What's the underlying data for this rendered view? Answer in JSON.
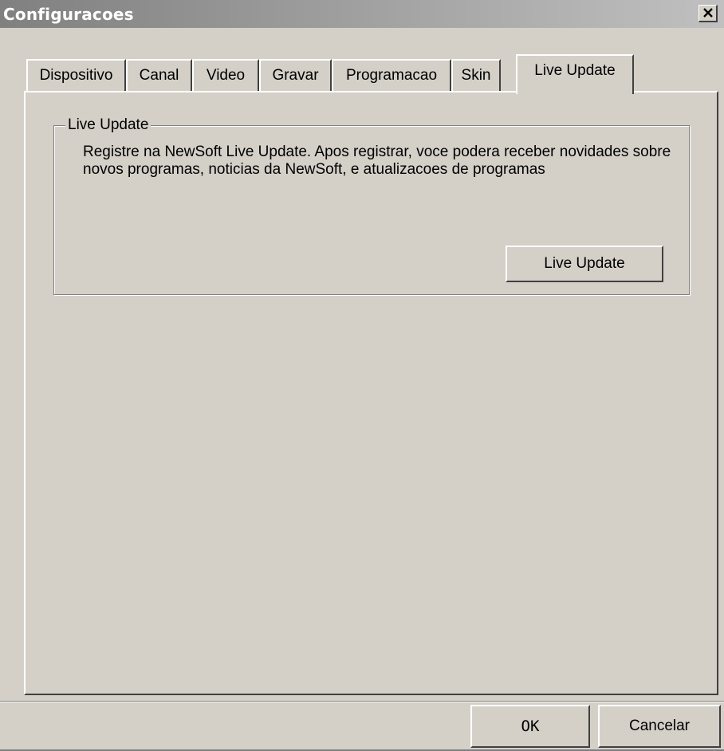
{
  "window": {
    "title": "Configuracoes",
    "close_symbol": "×",
    "title_gradient_colors": [
      "#808080",
      "#c0c0c0"
    ]
  },
  "tabs": [
    {
      "label": "Dispositivo",
      "active": false
    },
    {
      "label": "Canal",
      "active": false
    },
    {
      "label": "Video",
      "active": false
    },
    {
      "label": "Gravar",
      "active": false
    },
    {
      "label": "Programacao",
      "active": false
    },
    {
      "label": "Skin",
      "active": false
    },
    {
      "label": "Live Update",
      "active": true
    }
  ],
  "live_update_group": {
    "legend": "Live Update",
    "description": "Registre na NewSoft Live Update. Apos registrar, voce podera receber novidades sobre novos programas, noticias da NewSoft, e atualizacoes de programas",
    "button_label": "Live Update"
  },
  "footer": {
    "ok_label": "OK",
    "cancel_label": "Cancelar"
  },
  "colors": {
    "face": "#d4d0c8",
    "highlight": "#ffffff",
    "shadow": "#808080",
    "dark_shadow": "#404040"
  }
}
